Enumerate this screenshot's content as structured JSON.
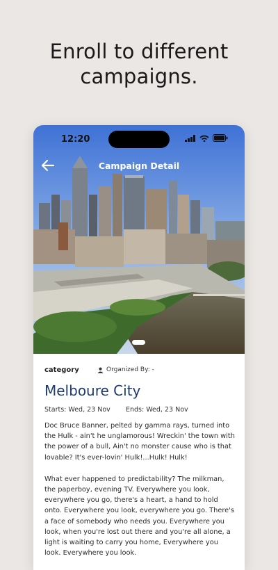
{
  "headline": {
    "line1": "Enroll to different",
    "line2": "campaigns."
  },
  "status_bar": {
    "time": "12:20",
    "icons": [
      "signal-icon",
      "wifi-icon",
      "battery-icon"
    ]
  },
  "app_bar": {
    "back_icon": "arrow-left-icon",
    "title": "Campaign Detail"
  },
  "campaign": {
    "category_label": "category",
    "organized_by": "Organized By: -",
    "title": "Melboure City",
    "starts": "Starts: Wed, 23 Nov",
    "ends": "Ends: Wed, 23 Nov",
    "description_p1": "Doc Bruce Banner, pelted by gamma rays, turned into the Hulk - ain't he unglamorous! Wreckin' the town with the power of a bull, Ain't no monster cause who is that lovable? It's ever-lovin' Hulk!...Hulk! Hulk!",
    "description_p2": "What ever happened to predictability? The milkman, the paperboy, evening TV. Everywhere you look, everywhere you go, there's a heart, a hand to hold onto. Everywhere you look, everywhere you go. There's a face of somebody who needs you. Everywhere you look, when you're lost out there and you're all alone, a light is waiting to carry you home, Everywhere you look. Everywhere you look."
  },
  "colors": {
    "page_background": "#ebe7e4",
    "title_color": "#1e3a6e"
  }
}
